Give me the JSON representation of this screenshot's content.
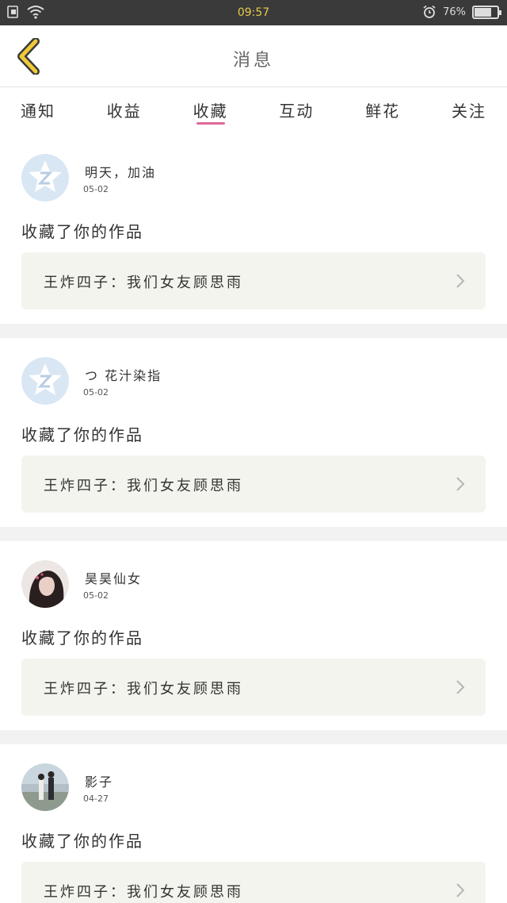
{
  "status_bar": {
    "time": "09:57",
    "battery": "76%",
    "battery_level": 0.76
  },
  "header": {
    "title": "消息",
    "back_icon": "chevron-left-icon"
  },
  "tabs": [
    {
      "label": "通知",
      "active": false
    },
    {
      "label": "收益",
      "active": false
    },
    {
      "label": "收藏",
      "active": true
    },
    {
      "label": "互动",
      "active": false
    },
    {
      "label": "鲜花",
      "active": false
    },
    {
      "label": "关注",
      "active": false
    }
  ],
  "feed": [
    {
      "name": "明天，加油",
      "date": "05-02",
      "action": "收藏了你的作品",
      "work": "王炸四子：我们女友顾思雨",
      "avatar": "default-qq-avatar"
    },
    {
      "name": "つ 花汁染指",
      "date": "05-02",
      "action": "收藏了你的作品",
      "work": "王炸四子：我们女友顾思雨",
      "avatar": "default-qq-avatar"
    },
    {
      "name": "昊昊仙女",
      "date": "05-02",
      "action": "收藏了你的作品",
      "work": "王炸四子：我们女友顾思雨",
      "avatar": "photo-girl-avatar"
    },
    {
      "name": "影子",
      "date": "04-27",
      "action": "收藏了你的作品",
      "work": "王炸四子：我们女友顾思雨",
      "avatar": "photo-couple-avatar"
    }
  ],
  "colors": {
    "accent": "#e06a98",
    "back_arrow": "#f0c93a",
    "card_bg": "#f4f4ef"
  }
}
